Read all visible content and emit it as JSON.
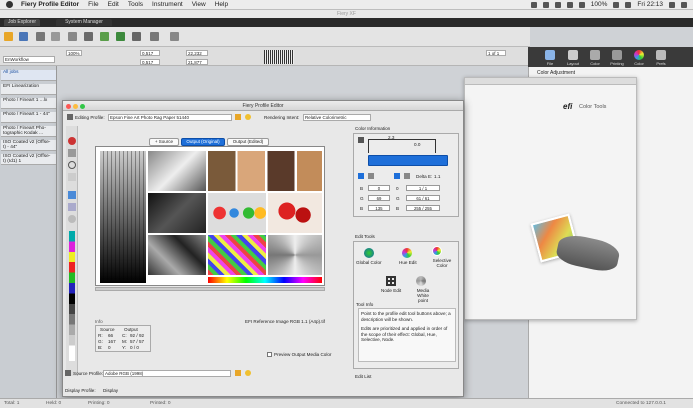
{
  "menubar": {
    "app_name": "Fiery Profile Editor",
    "items": [
      "File",
      "Edit",
      "Tools",
      "Instrument",
      "View",
      "Help"
    ],
    "battery": "100%",
    "clock": "Fri 22:13"
  },
  "titlebar": {
    "text": "Fiery XF"
  },
  "tabs": [
    "Job Explorer",
    "System Manager"
  ],
  "toolbar": {
    "zoom": "100%",
    "x_value": "0,517",
    "y_value": "0,517",
    "width_value": "22,232",
    "height_value": "21,877",
    "pages": "1 of 1"
  },
  "sidebar": {
    "workflow": "EnWorkflow",
    "items": [
      "All jobs",
      "EFI Linearization",
      "Photo / Fineart 1 ...lx",
      "Photo / Fineart 1 - 44\"",
      "Photo / Fineart Pho-\ntographic Kodak ...",
      "ISO Coated v2 (Offse-\nt) - 44\"",
      "ISO Coated v2 (Offse-\nt) (Id1) 1"
    ]
  },
  "right_panel": {
    "tabs": [
      "File",
      "Layout",
      "Color",
      "Printing",
      "Color",
      "Prefs"
    ],
    "section": "Color Adjustment"
  },
  "efi_window": {
    "brand": "efi",
    "product": "Color Tools"
  },
  "profile_editor": {
    "title": "Fiery Profile Editor",
    "editing_profile_label": "Editing Profile:",
    "editing_profile_value": "Epson Fine Art Photo Rag Paper 51440",
    "rendering_intent_label": "Rendering Intent:",
    "rendering_intent_value": "Relative Colorimetric",
    "view_tabs": [
      "+ Source",
      "Output (Original)",
      "Output (Edited)"
    ],
    "image_caption": "EFI Reference Image RGB 1.1 (A4p).tif",
    "info_label": "Info",
    "info_source_label": "Source",
    "info_output_label": "Output",
    "info_rows": [
      {
        "k": "R:",
        "v": "66",
        "ok": "C:",
        "ov": "92 / 92"
      },
      {
        "k": "G:",
        "v": "167",
        "ok": "M:",
        "ov": "57 / 57"
      },
      {
        "k": "B:",
        "v": "0",
        "ok": "Y:",
        "ov": "0 / 0"
      }
    ],
    "preview_checkbox": "Preview Output Media Color",
    "source_profile_label": "Source Profile:",
    "source_profile_value": "Adobe RGB (1998)",
    "display_profile_label": "Display Profile:",
    "display_profile_value": "Display"
  },
  "color_info": {
    "title": "Color Information",
    "top_values": [
      "2.3",
      "0.0"
    ],
    "delta_label": "Delta E:",
    "delta_value": "1.1",
    "rows": [
      {
        "label": "B",
        "value": "0",
        "label2": "0",
        "value2": "1 / 1"
      },
      {
        "label": "G",
        "value": "69",
        "label2": "G",
        "value2": "61 / 61"
      },
      {
        "label": "B",
        "value": "135",
        "label2": "B",
        "value2": "255 / 255"
      }
    ]
  },
  "edit_tools": {
    "title": "Edit Tools",
    "tools": [
      {
        "name": "Global Color"
      },
      {
        "name": "Hue Edit"
      },
      {
        "name": "Selective Color"
      },
      {
        "name": "Node Edit"
      },
      {
        "name": "Media White point"
      }
    ],
    "tool_info_title": "Tool Info",
    "tool_info_text1": "Point to the profile edit tool buttons above; a description will be shown.",
    "tool_info_text2": "Edits are prioritized and applied in order of the scope of their effect: Global, Hue, Selective, Node.",
    "edit_list_label": "Edit List"
  },
  "status_bar": [
    "Total: 1",
    "Held: 0",
    "Printing: 0",
    "Printed: 0",
    "Connected to 127.0.0.1"
  ],
  "colors": {
    "accent": "#1e6fd9",
    "dark": "#2a2a2a"
  }
}
